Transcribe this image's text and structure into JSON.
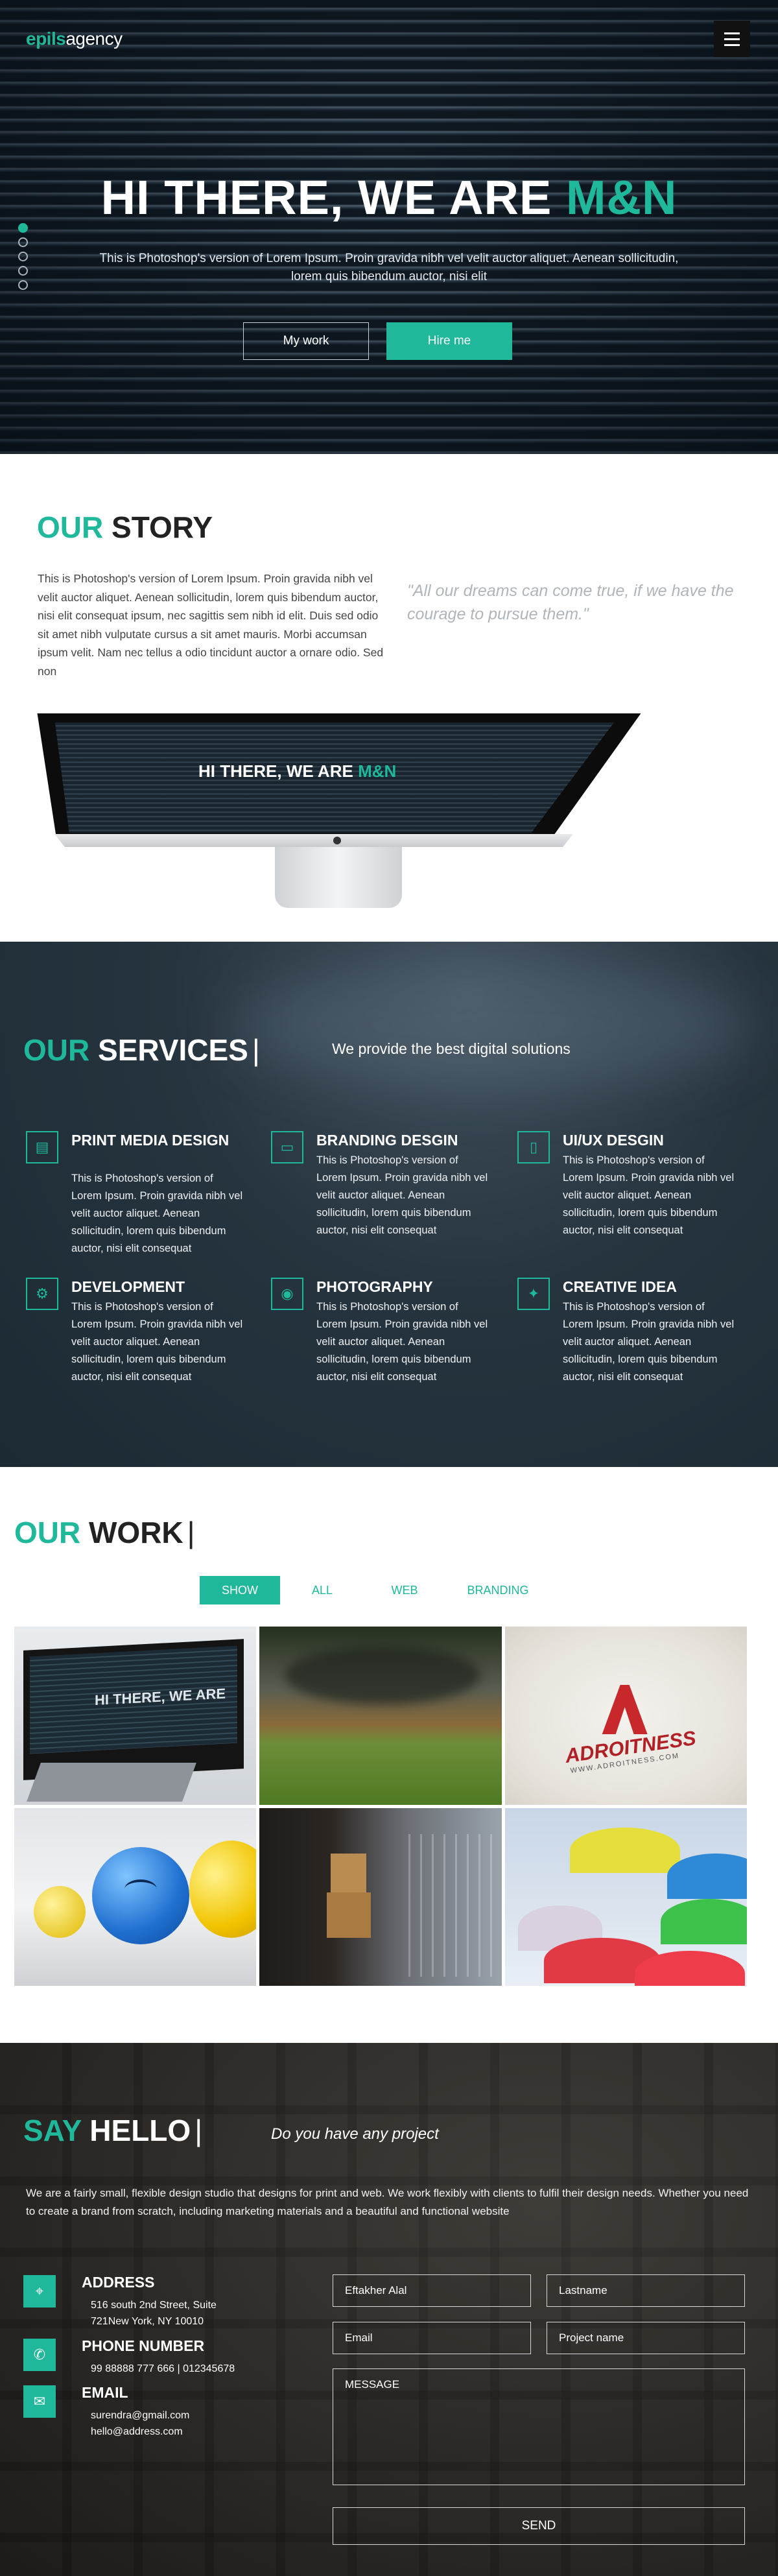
{
  "header": {
    "logo_part1": "epils",
    "logo_part2": "agency"
  },
  "hero": {
    "title_main": "HI THERE, WE ARE ",
    "title_accent": "M&N",
    "subtitle": "This is Photoshop's version of Lorem Ipsum. Proin gravida nibh vel velit auctor aliquet. Aenean sollicitudin, lorem quis bibendum auctor, nisi elit",
    "btn_work": "My work",
    "btn_hire": "Hire me"
  },
  "story": {
    "title_accent": "OUR",
    "title_main": " STORY",
    "text": "This is Photoshop's version of Lorem Ipsum. Proin gravida nibh vel velit auctor aliquet. Aenean sollicitudin, lorem quis bibendum auctor, nisi elit consequat ipsum, nec sagittis sem nibh id elit. Duis sed odio sit amet nibh vulputate cursus a sit amet mauris. Morbi accumsan ipsum velit. Nam nec tellus a odio tincidunt auctor a ornare odio. Sed non",
    "quote": "\"All our dreams can come true, if we have the courage to pursue them.\""
  },
  "services": {
    "title_accent": "OUR",
    "title_main": " SERVICES",
    "bar": "|",
    "subtitle": "We provide the best digital solutions",
    "items": [
      {
        "title": "PRINT MEDIA DESIGN",
        "text": "This is Photoshop's version of Lorem Ipsum. Proin gravida nibh vel velit auctor aliquet. Aenean sollicitudin, lorem quis bibendum auctor, nisi elit consequat"
      },
      {
        "title": "BRANDING DESGIN",
        "text": "This is Photoshop's version of Lorem Ipsum. Proin gravida nibh vel velit auctor aliquet. Aenean sollicitudin, lorem quis bibendum auctor, nisi elit consequat"
      },
      {
        "title": "UI/UX DESGIN",
        "text": "This is Photoshop's version of Lorem Ipsum. Proin gravida nibh vel velit auctor aliquet. Aenean sollicitudin, lorem quis bibendum auctor, nisi elit consequat"
      },
      {
        "title": "DEVELOPMENT",
        "text": "This is Photoshop's version of Lorem Ipsum. Proin gravida nibh vel velit auctor aliquet. Aenean sollicitudin, lorem quis bibendum auctor, nisi elit consequat"
      },
      {
        "title": "PHOTOGRAPHY",
        "text": "This is Photoshop's version of Lorem Ipsum. Proin gravida nibh vel velit auctor aliquet. Aenean sollicitudin, lorem quis bibendum auctor, nisi elit consequat"
      },
      {
        "title": "CREATIVE IDEA",
        "text": "This is Photoshop's version of Lorem Ipsum. Proin gravida nibh vel velit auctor aliquet. Aenean sollicitudin, lorem quis bibendum auctor, nisi elit consequat"
      }
    ]
  },
  "work": {
    "title_accent": "OUR",
    "title_main": " WORK",
    "bar": "|",
    "filters": [
      "SHOW",
      "ALL",
      "WEB",
      "BRANDING"
    ],
    "tiles": {
      "monitor_text": "HI THERE, WE ARE",
      "brand_name": "ADROITNESS",
      "brand_tag": "WWW.ADROITNESS.COM"
    }
  },
  "contact": {
    "title_accent": "SAY",
    "title_main": " HELLO",
    "bar": "|",
    "subtitle": "Do you have any project",
    "text": "We are a fairly small, flexible design studio that designs for print and web. We work flexibly with clients to fulfil their design needs. Whether you need to create a brand from scratch, including marketing materials and a beautiful and functional website",
    "address_label": "ADDRESS",
    "address_lines": [
      "516 south 2nd Street, Suite",
      "721New York, NY 10010"
    ],
    "phone_label": "PHONE NUMBER",
    "phone_lines": [
      "99 88888 777 666 | 012345678"
    ],
    "email_label": "EMAIL",
    "email_lines": [
      "surendra@gmail.com",
      "hello@address.com"
    ],
    "form": {
      "first_name_value": "Eftakher Alal",
      "lastname_placeholder": "Lastname",
      "email_placeholder": "Email",
      "project_placeholder": "Project name",
      "message_placeholder": "MESSAGE",
      "send_label": "SEND"
    }
  }
}
